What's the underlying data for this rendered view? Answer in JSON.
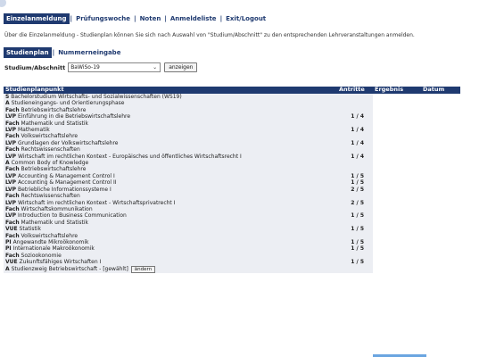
{
  "topnav": {
    "items": [
      {
        "label": "Einzelanmeldung",
        "active": true
      },
      {
        "label": "Prüfungswoche",
        "active": false
      },
      {
        "label": "Noten",
        "active": false
      },
      {
        "label": "Anmeldeliste",
        "active": false
      },
      {
        "label": "Exit/Logout",
        "active": false
      }
    ],
    "separator": "|"
  },
  "intro_text": "Über die Einzelanmeldung - Studienplan können Sie sich nach Auswahl von \"Studium/Abschnitt\" zu den entsprechenden Lehrveranstaltungen anmelden.",
  "subnav": {
    "items": [
      {
        "label": "Studienplan",
        "active": true
      },
      {
        "label": "Nummerneingabe",
        "active": false
      }
    ],
    "separator": "|"
  },
  "filter": {
    "label": "Studium/Abschnitt",
    "selected": "BaWiSo-19",
    "button": "anzeigen"
  },
  "table": {
    "headers": [
      "Studienplanpunkt",
      "Antritte",
      "Ergebnis",
      "Datum"
    ],
    "rows": [
      {
        "tag": "S",
        "text": "Bachelorstudium Wirtschafts- und Sozialwissenschaften (WS19)",
        "indent": 0,
        "antritte": ""
      },
      {
        "tag": "A",
        "text": "Studieneingangs- und Orientierungsphase",
        "indent": 1,
        "antritte": ""
      },
      {
        "tag": "Fach",
        "text": "Betriebswirtschaftslehre",
        "indent": 2,
        "antritte": ""
      },
      {
        "tag": "LVP",
        "text": "Einführung in die Betriebswirtschaftslehre",
        "indent": 3,
        "antritte": "1 / 4"
      },
      {
        "tag": "Fach",
        "text": "Mathematik und Statistik",
        "indent": 2,
        "antritte": ""
      },
      {
        "tag": "LVP",
        "text": "Mathematik",
        "indent": 3,
        "antritte": "1 / 4"
      },
      {
        "tag": "Fach",
        "text": "Volkswirtschaftslehre",
        "indent": 2,
        "antritte": ""
      },
      {
        "tag": "LVP",
        "text": "Grundlagen der Volkswirtschaftslehre",
        "indent": 3,
        "antritte": "1 / 4"
      },
      {
        "tag": "Fach",
        "text": "Rechtswissenschaften",
        "indent": 2,
        "antritte": ""
      },
      {
        "tag": "LVP",
        "text": "Wirtschaft im rechtlichen Kontext - Europäisches und öffentliches Wirtschaftsrecht I",
        "indent": 3,
        "antritte": "1 / 4"
      },
      {
        "tag": "A",
        "text": "Common Body of Knowledge",
        "indent": 1,
        "antritte": ""
      },
      {
        "tag": "Fach",
        "text": "Betriebswirtschaftslehre",
        "indent": 2,
        "antritte": ""
      },
      {
        "tag": "LVP",
        "text": "Accounting & Management Control I",
        "indent": 3,
        "antritte": "1 / 5"
      },
      {
        "tag": "LVP",
        "text": "Accounting & Management Control II",
        "indent": 3,
        "antritte": "1 / 5"
      },
      {
        "tag": "LVP",
        "text": "Betriebliche Informationssysteme I",
        "indent": 3,
        "antritte": "2 / 5"
      },
      {
        "tag": "Fach",
        "text": "Rechtswissenschaften",
        "indent": 2,
        "antritte": ""
      },
      {
        "tag": "LVP",
        "text": "Wirtschaft im rechtlichen Kontext - Wirtschaftsprivatrecht I",
        "indent": 3,
        "antritte": "2 / 5"
      },
      {
        "tag": "Fach",
        "text": "Wirtschaftskommunikation",
        "indent": 2,
        "antritte": ""
      },
      {
        "tag": "LVP",
        "text": "Introduction to Business Communication",
        "indent": 3,
        "antritte": "1 / 5"
      },
      {
        "tag": "Fach",
        "text": "Mathematik und Statistik",
        "indent": 2,
        "antritte": ""
      },
      {
        "tag": "VUE",
        "text": "Statistik",
        "indent": 3,
        "antritte": "1 / 5"
      },
      {
        "tag": "Fach",
        "text": "Volkswirtschaftslehre",
        "indent": 2,
        "antritte": ""
      },
      {
        "tag": "PI",
        "text": "Angewandte Mikroökonomik",
        "indent": 3,
        "antritte": "1 / 5"
      },
      {
        "tag": "PI",
        "text": "Internationale Makroökonomik",
        "indent": 3,
        "antritte": "1 / 5"
      },
      {
        "tag": "Fach",
        "text": "Soziookonomie",
        "indent": 2,
        "antritte": ""
      },
      {
        "tag": "VUE",
        "text": "Zukunftsfähiges Wirtschaften I",
        "indent": 3,
        "antritte": "1 / 5"
      },
      {
        "tag": "A",
        "text": "Studienzweig Betriebswirtschaft - [gewählt]",
        "indent": 1,
        "antritte": "",
        "button": "ändern"
      }
    ]
  },
  "colors": {
    "nav_blue": "#1f3a70",
    "row_shade": "#eceef3",
    "accent_rule": "#6aa5e0"
  }
}
